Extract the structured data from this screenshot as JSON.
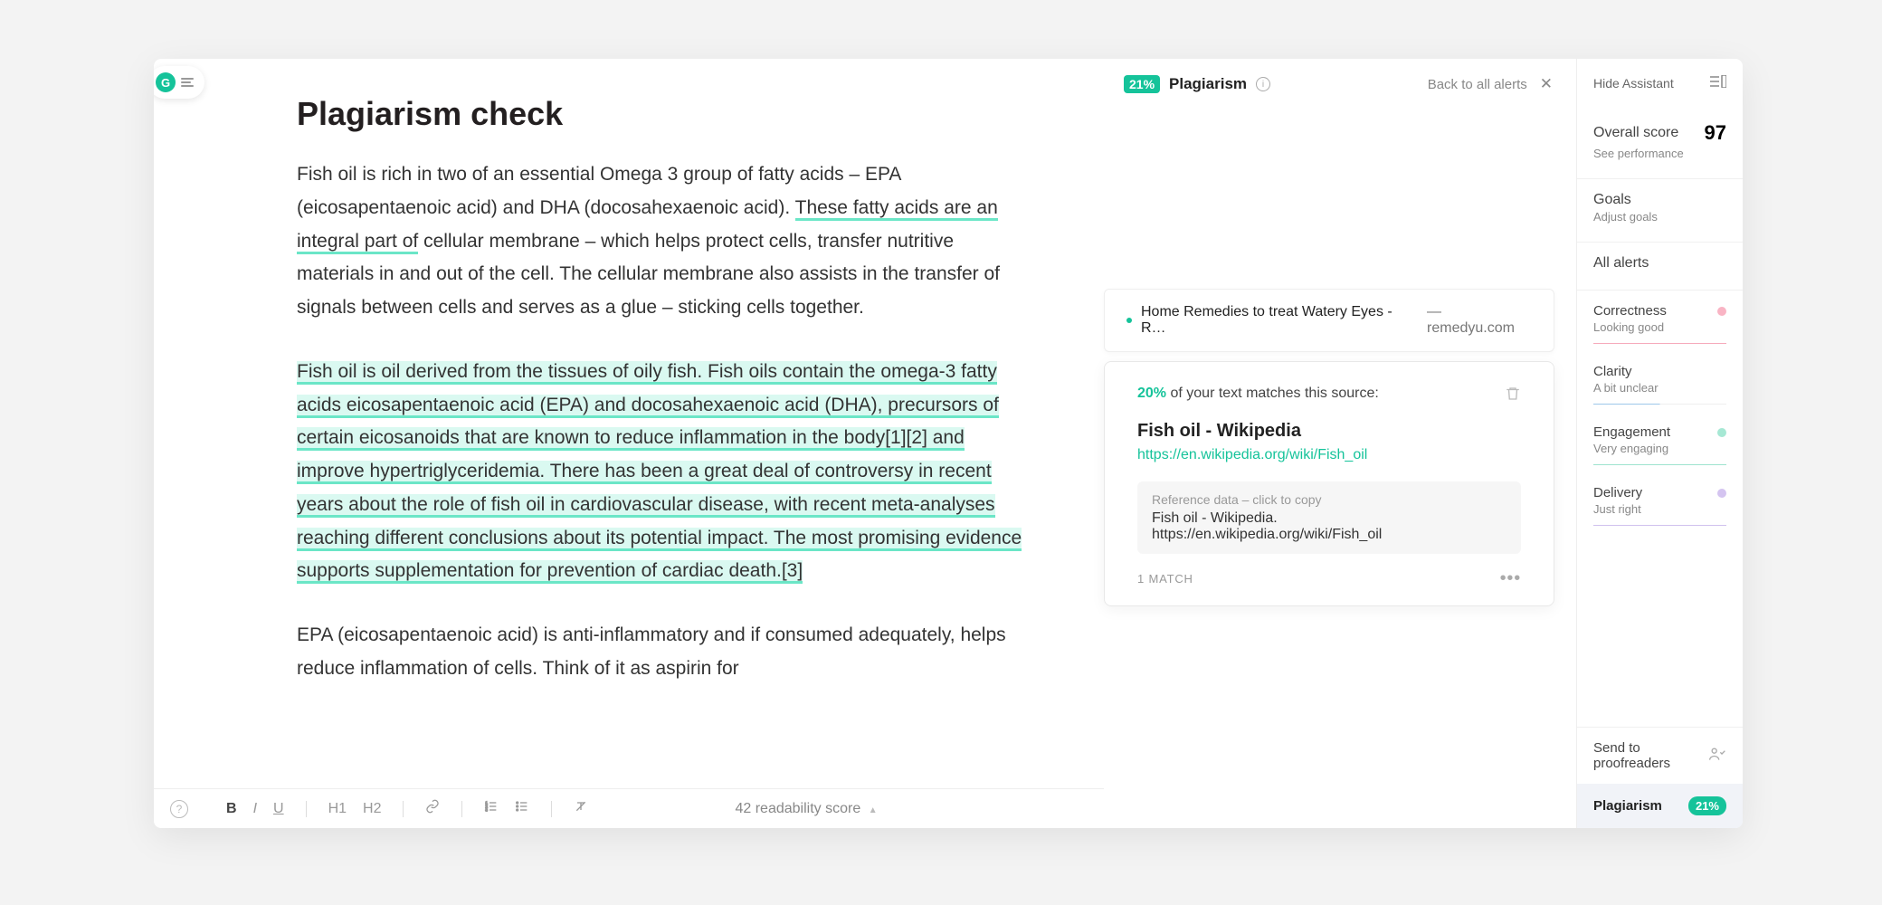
{
  "logo_letter": "G",
  "document": {
    "title": "Plagiarism check",
    "para1_a": "Fish oil is rich in two of an essential Omega 3 group of fatty acids – EPA (eicosapentaenoic acid) and DHA (docosahexaenoic acid). ",
    "para1_hl": "These fatty acids are an integral part of",
    "para1_b": " cellular membrane – which helps protect cells, transfer nutritive materials in and out of the cell. The cellular membrane also assists in the transfer of signals between cells and serves as a glue – sticking cells together.",
    "para2": "Fish oil is oil derived from the tissues of oily fish. Fish oils contain the omega-3 fatty acids eicosapentaenoic acid (EPA) and docosahexaenoic acid (DHA), precursors of certain eicosanoids that are known to reduce inflammation in the body[1][2] and improve hypertriglyceridemia. There has been a great deal of controversy in recent years about the role of fish oil in cardiovascular disease, with recent meta-analyses reaching different conclusions about its potential impact. The most promising evidence supports supplementation for prevention of cardiac death.[3]",
    "para3": "EPA (eicosapentaenoic acid) is anti-inflammatory and if consumed adequately, helps reduce inflammation of cells. Think of it as aspirin for"
  },
  "toolbar": {
    "bold": "B",
    "italic": "I",
    "underline": "U",
    "h1": "H1",
    "h2": "H2"
  },
  "readability": "42 readability score",
  "alerts": {
    "badge_percent": "21%",
    "header_label": "Plagiarism",
    "back_label": "Back to all alerts",
    "source_preview": {
      "title": "Home Remedies to treat Watery Eyes - R…",
      "domain": " — remedyu.com"
    },
    "match": {
      "percent": "20%",
      "of_text": " of your text matches this source:",
      "title": "Fish oil - Wikipedia",
      "url": "https://en.wikipedia.org/wiki/Fish_oil",
      "ref_label": "Reference data – click to copy",
      "ref_value": "Fish oil - Wikipedia. https://en.wikipedia.org/wiki/Fish_oil",
      "match_count": "1 MATCH"
    }
  },
  "sidebar": {
    "hide": "Hide Assistant",
    "overall_label": "Overall score",
    "overall_value": "97",
    "overall_sub": "See performance",
    "goals_label": "Goals",
    "goals_sub": "Adjust goals",
    "all_alerts": "All alerts",
    "correctness": {
      "title": "Correctness",
      "sub": "Looking good"
    },
    "clarity": {
      "title": "Clarity",
      "sub": "A bit unclear"
    },
    "engagement": {
      "title": "Engagement",
      "sub": "Very engaging"
    },
    "delivery": {
      "title": "Delivery",
      "sub": "Just right"
    },
    "proofread": "Send to proofreaders",
    "plagiarism_label": "Plagiarism",
    "plagiarism_percent": "21%"
  }
}
